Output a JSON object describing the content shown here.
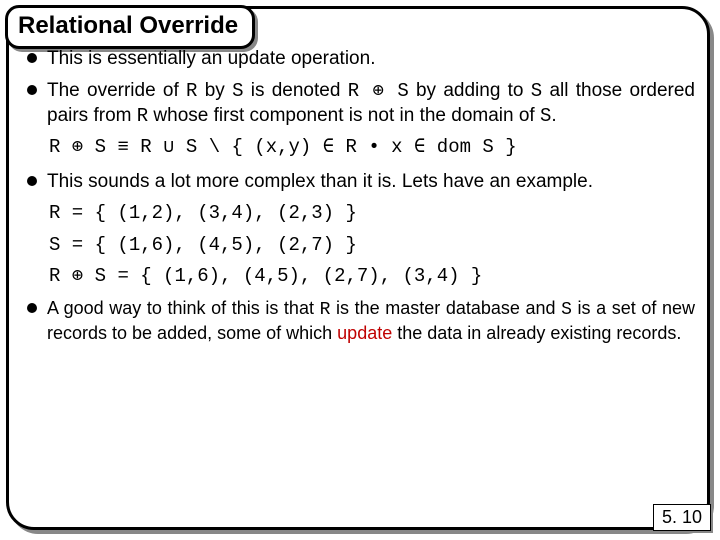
{
  "title": "Relational Override",
  "bullets": {
    "b1": "This is essentially an update operation.",
    "b2_pre": "The override of ",
    "b2_R": "R",
    "b2_by": " by ",
    "b2_S": "S",
    "b2_den": " is denoted ",
    "b2_expr": "R ⊕ S",
    "b2_add": " by adding to ",
    "b2_S2": "S",
    "b2_all": " all those ordered pairs from ",
    "b2_R2": "R",
    "b2_tail": " whose first component is not in the domain of ",
    "b2_S3": "S",
    "b2_dot": ".",
    "formula": "R ⊕ S ≡ R ∪ S \\ { (x,y) ∈ R • x ∈ dom S }",
    "b3": "This sounds a lot more complex than it is. Lets have an example.",
    "ex1": "R = { (1,2), (3,4), (2,3) }",
    "ex2": "S = { (1,6), (4,5), (2,7) }",
    "ex3": "R ⊕ S = { (1,6), (4,5), (2,7), (3,4) }",
    "b4_pre": "A good way to think of this is that ",
    "b4_R": "R",
    "b4_mid1": " is the master database and ",
    "b4_S": "S",
    "b4_mid2": " is a set of new records to be added, some of which ",
    "b4_update": "update",
    "b4_tail": " the data in already existing records."
  },
  "pagenum": "5. 10"
}
